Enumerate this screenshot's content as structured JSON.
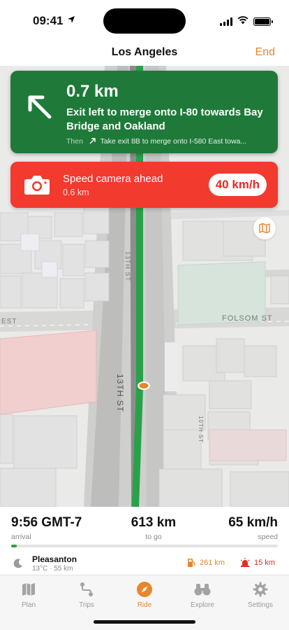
{
  "status_bar": {
    "time": "09:41"
  },
  "header": {
    "title": "Los Angeles",
    "end_label": "End"
  },
  "navigation": {
    "distance": "0.7 km",
    "instruction": "Exit left to merge onto I-80 towards Bay Bridge and Oakland",
    "then_label": "Then",
    "then_instruction": "Take exit 8B to merge onto I-580 East towa..."
  },
  "speed_camera": {
    "title": "Speed camera ahead",
    "distance": "0.6 km",
    "limit": "40 km/h"
  },
  "map": {
    "street_labels": [
      "13TH ST",
      "13TH ST",
      "FOLSOM ST",
      "EST",
      "10TH ST"
    ]
  },
  "trip": {
    "arrival": "9:56 GMT-7",
    "arrival_label": "arrival",
    "to_go": "613 km",
    "to_go_label": "to go",
    "speed": "65 km/h",
    "speed_label": "speed",
    "progress": 0.02,
    "destination": "Pleasanton",
    "destination_meta": "13°C · 55 km",
    "fuel_distance": "261 km",
    "camera_distance": "15 km"
  },
  "tabs": [
    {
      "label": "Plan",
      "icon": "map-icon"
    },
    {
      "label": "Trips",
      "icon": "route-icon"
    },
    {
      "label": "Ride",
      "icon": "compass-icon",
      "active": true
    },
    {
      "label": "Explore",
      "icon": "binoculars-icon"
    },
    {
      "label": "Settings",
      "icon": "gear-icon"
    }
  ],
  "colors": {
    "accent": "#e8862a",
    "nav_green": "#1f7a3a",
    "alert_red": "#f23a2f",
    "route_green": "#27a249"
  }
}
